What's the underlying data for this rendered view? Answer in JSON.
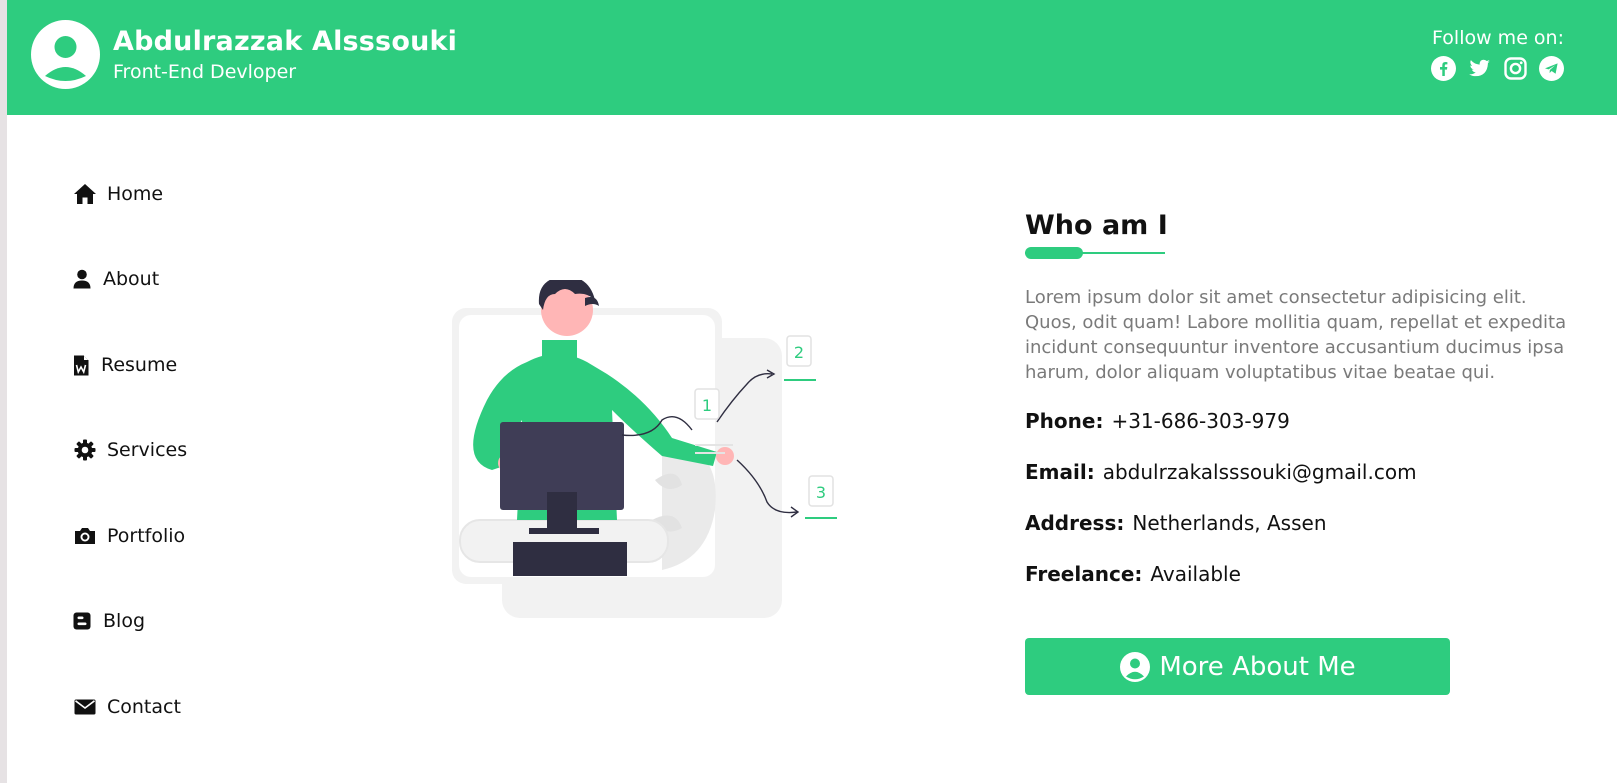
{
  "header": {
    "name": "Abdulrazzak Alsssouki",
    "role": "Front-End Devloper",
    "follow_label": "Follow me on:",
    "socials": [
      "facebook-icon",
      "twitter-icon",
      "instagram-icon",
      "telegram-icon"
    ]
  },
  "nav": {
    "items": [
      {
        "label": "Home",
        "icon": "home-icon"
      },
      {
        "label": "About",
        "icon": "user-icon"
      },
      {
        "label": "Resume",
        "icon": "word-file-icon"
      },
      {
        "label": "Services",
        "icon": "gear-icon"
      },
      {
        "label": "Portfolio",
        "icon": "camera-icon"
      },
      {
        "label": "Blog",
        "icon": "blogger-icon"
      },
      {
        "label": "Contact",
        "icon": "envelope-icon"
      }
    ]
  },
  "illustration": {
    "markers": [
      "1",
      "2",
      "3"
    ]
  },
  "about": {
    "title": "Who am I",
    "bio": "Lorem ipsum dolor sit amet consectetur adipisicing elit. Quos, odit quam! Labore mollitia quam, repellat et expedita incidunt consequuntur inventore accusantium ducimus ipsa harum, dolor aliquam voluptatibus vitae beatae qui.",
    "phone_label": "Phone:",
    "phone": "+31-686-303-979",
    "email_label": "Email:",
    "email": "abdulrzakalsssouki@gmail.com",
    "address_label": "Address:",
    "address": "Netherlands, Assen",
    "freelance_label": "Freelance:",
    "freelance": "Available",
    "button_label": "More About Me"
  },
  "colors": {
    "accent": "#2ecc7f",
    "text": "#111111",
    "muted": "#7a7a7a"
  }
}
